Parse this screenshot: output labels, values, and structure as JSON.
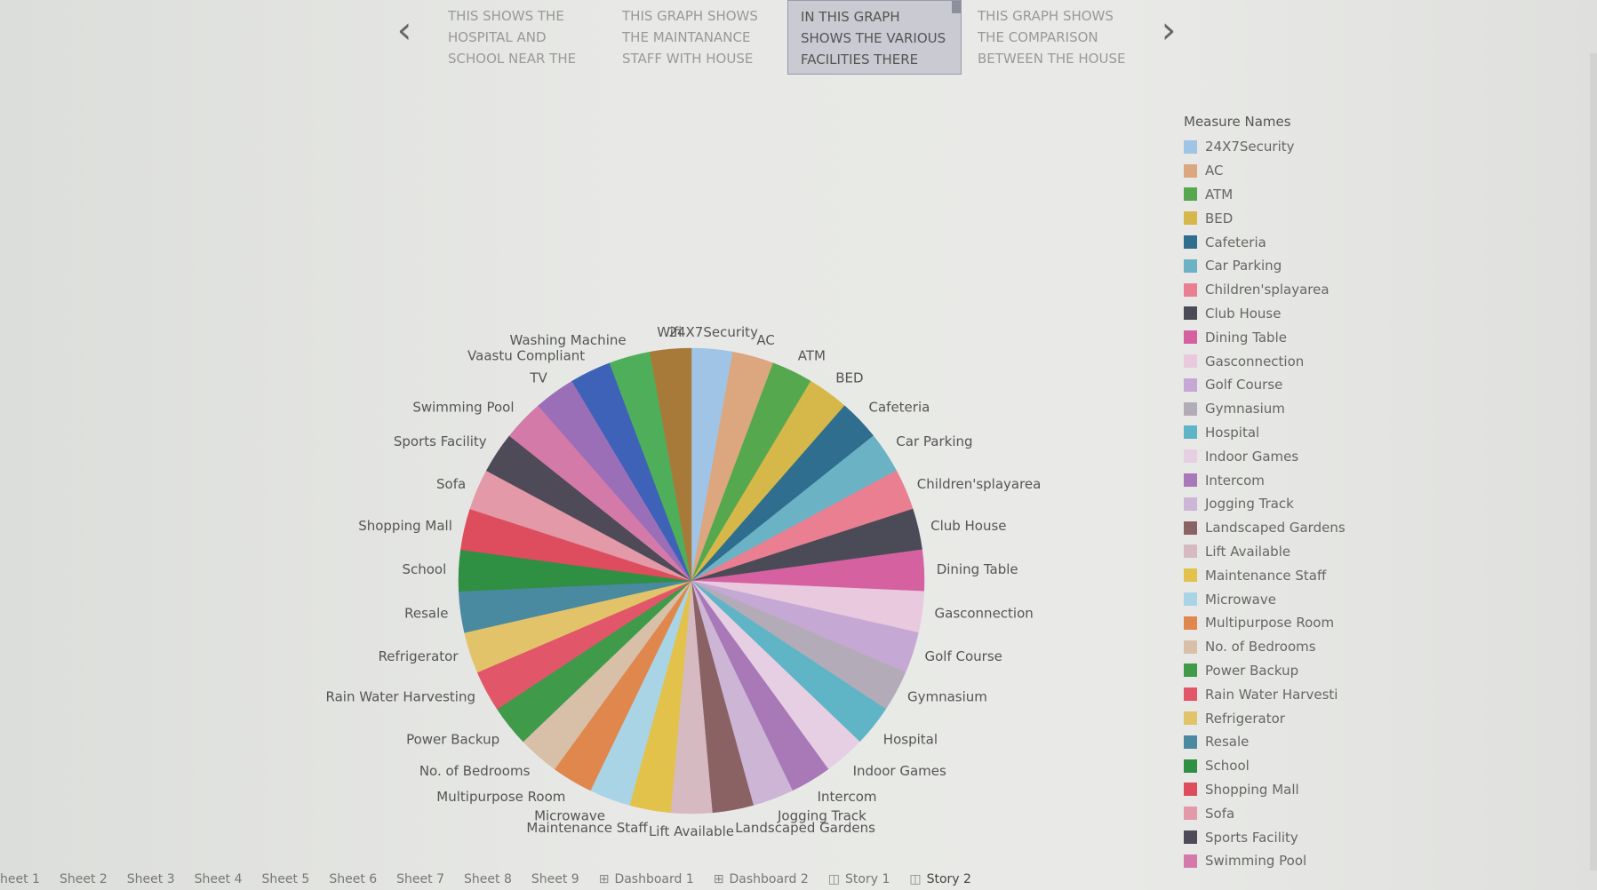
{
  "story_points": [
    {
      "text": "THIS SHOWS THE HOSPITAL AND SCHOOL NEAR THE"
    },
    {
      "text": "THIS GRAPH SHOWS THE MAINTANANCE STAFF WITH HOUSE"
    },
    {
      "text": "IN THIS GRAPH SHOWS THE VARIOUS FACILITIES THERE"
    },
    {
      "text": "THIS GRAPH SHOWS THE COMPARISON BETWEEN THE HOUSE"
    }
  ],
  "nav": {
    "prev_icon": "chevron-left-icon",
    "next_icon": "chevron-right-icon",
    "prev": "‹",
    "next": "›"
  },
  "legend": {
    "title": "Measure Names",
    "items": [
      {
        "label": "24X7Security",
        "color": "#9fc4e6"
      },
      {
        "label": "AC",
        "color": "#dca77f"
      },
      {
        "label": "ATM",
        "color": "#55a84e"
      },
      {
        "label": "BED",
        "color": "#d6b84a"
      },
      {
        "label": "Cafeteria",
        "color": "#2f6e8e"
      },
      {
        "label": "Car Parking",
        "color": "#6bb3c4"
      },
      {
        "label": "Children'splayarea",
        "color": "#ea7f92"
      },
      {
        "label": "Club House",
        "color": "#4b4b57"
      },
      {
        "label": "Dining Table",
        "color": "#d661a0"
      },
      {
        "label": "Gasconnection",
        "color": "#e9c9de"
      },
      {
        "label": "Golf Course",
        "color": "#c5a8d4"
      },
      {
        "label": "Gymnasium",
        "color": "#b3acb8"
      },
      {
        "label": "Hospital",
        "color": "#5fb4c6"
      },
      {
        "label": "Indoor Games",
        "color": "#e6cfe3"
      },
      {
        "label": "Intercom",
        "color": "#a878b7"
      },
      {
        "label": "Jogging Track",
        "color": "#cdb5d6"
      },
      {
        "label": "Landscaped Gardens",
        "color": "#8b6264"
      },
      {
        "label": "Lift Available",
        "color": "#d6bac2"
      },
      {
        "label": "Maintenance Staff",
        "color": "#e2c24a"
      },
      {
        "label": "Microwave",
        "color": "#a8d4e6"
      },
      {
        "label": "Multipurpose Room",
        "color": "#e0874e"
      },
      {
        "label": "No. of Bedrooms",
        "color": "#d8bfa8"
      },
      {
        "label": "Power Backup",
        "color": "#3f9a4a"
      },
      {
        "label": "Rain Water Harvesti",
        "color": "#e2566a"
      },
      {
        "label": "Refrigerator",
        "color": "#e3c36a"
      },
      {
        "label": "Resale",
        "color": "#4a8aa0"
      },
      {
        "label": "School",
        "color": "#2f8f43"
      },
      {
        "label": "Shopping Mall",
        "color": "#dd4d5e"
      },
      {
        "label": "Sofa",
        "color": "#e399a8"
      },
      {
        "label": "Sports Facility",
        "color": "#4e4a58"
      },
      {
        "label": "Swimming Pool",
        "color": "#d47aa8"
      }
    ]
  },
  "chart_data": {
    "type": "pie",
    "title": "",
    "legend_placement": "right",
    "slices": [
      {
        "label": "24X7Security",
        "value": 1,
        "color": "#9fc4e6"
      },
      {
        "label": "AC",
        "value": 1,
        "color": "#dca77f"
      },
      {
        "label": "ATM",
        "value": 1,
        "color": "#55a84e"
      },
      {
        "label": "BED",
        "value": 1,
        "color": "#d6b84a"
      },
      {
        "label": "Cafeteria",
        "value": 1,
        "color": "#2f6e8e"
      },
      {
        "label": "Car Parking",
        "value": 1,
        "color": "#6bb3c4"
      },
      {
        "label": "Children'splayarea",
        "value": 1,
        "color": "#ea7f92"
      },
      {
        "label": "Club House",
        "value": 1,
        "color": "#4b4b57"
      },
      {
        "label": "Dining Table",
        "value": 1,
        "color": "#d661a0"
      },
      {
        "label": "Gasconnection",
        "value": 1,
        "color": "#e9c9de"
      },
      {
        "label": "Golf Course",
        "value": 1,
        "color": "#c5a8d4"
      },
      {
        "label": "Gymnasium",
        "value": 1,
        "color": "#b3acb8"
      },
      {
        "label": "Hospital",
        "value": 1,
        "color": "#5fb4c6"
      },
      {
        "label": "Indoor Games",
        "value": 1,
        "color": "#e6cfe3"
      },
      {
        "label": "Intercom",
        "value": 1,
        "color": "#a878b7"
      },
      {
        "label": "Jogging Track",
        "value": 1,
        "color": "#cdb5d6"
      },
      {
        "label": "Landscaped Gardens",
        "value": 1,
        "color": "#8b6264"
      },
      {
        "label": "Lift Available",
        "value": 1,
        "color": "#d6bac2"
      },
      {
        "label": "Maintenance Staff",
        "value": 1,
        "color": "#e2c24a"
      },
      {
        "label": "Microwave",
        "value": 1,
        "color": "#a8d4e6"
      },
      {
        "label": "Multipurpose Room",
        "value": 1,
        "color": "#e0874e"
      },
      {
        "label": "No. of Bedrooms",
        "value": 1,
        "color": "#d8bfa8"
      },
      {
        "label": "Power Backup",
        "value": 1,
        "color": "#3f9a4a"
      },
      {
        "label": "Rain Water Harvesting",
        "value": 1,
        "color": "#e2566a"
      },
      {
        "label": "Refrigerator",
        "value": 1,
        "color": "#e3c36a"
      },
      {
        "label": "Resale",
        "value": 1,
        "color": "#4a8aa0"
      },
      {
        "label": "School",
        "value": 1,
        "color": "#2f8f43"
      },
      {
        "label": "Shopping Mall",
        "value": 1,
        "color": "#dd4d5e"
      },
      {
        "label": "Sofa",
        "value": 1,
        "color": "#e399a8"
      },
      {
        "label": "Sports Facility",
        "value": 1,
        "color": "#4e4a58"
      },
      {
        "label": "Swimming Pool",
        "value": 1,
        "color": "#d47aa8"
      },
      {
        "label": "TV",
        "value": 1,
        "color": "#9b6fb8"
      },
      {
        "label": "Vaastu Compliant",
        "value": 1,
        "color": "#3e62b8"
      },
      {
        "label": "Washing Machine",
        "value": 1,
        "color": "#4fae5a"
      },
      {
        "label": "Wifi",
        "value": 1,
        "color": "#a87a3a"
      }
    ]
  },
  "sheet_tabs": [
    {
      "label": "heet 1"
    },
    {
      "label": "Sheet 2"
    },
    {
      "label": "Sheet 3"
    },
    {
      "label": "Sheet 4"
    },
    {
      "label": "Sheet 5"
    },
    {
      "label": "Sheet 6"
    },
    {
      "label": "Sheet 7"
    },
    {
      "label": "Sheet 8"
    },
    {
      "label": "Sheet 9"
    },
    {
      "label": "Dashboard 1",
      "icon": "⊞"
    },
    {
      "label": "Dashboard 2",
      "icon": "⊞"
    },
    {
      "label": "Story 1",
      "icon": "◫"
    },
    {
      "label": "Story 2",
      "icon": "◫"
    }
  ]
}
